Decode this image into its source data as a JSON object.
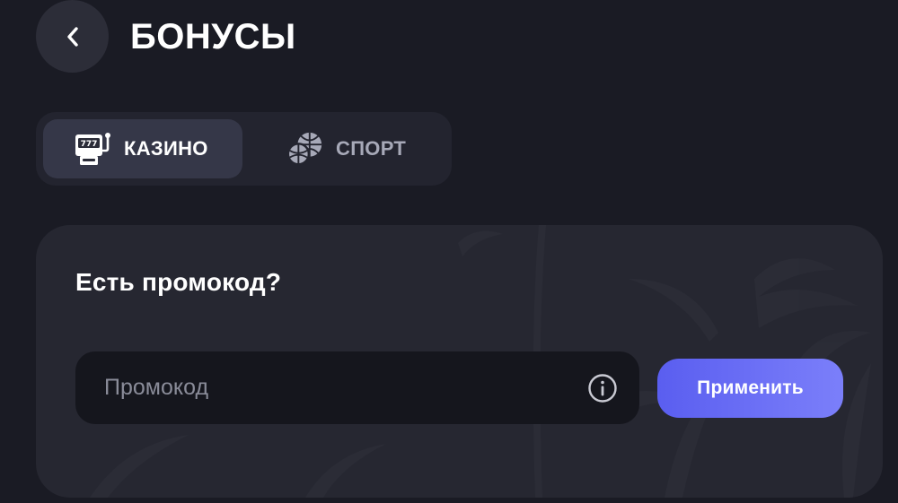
{
  "header": {
    "back_icon": "chevron-left-icon",
    "title": "БОНУСЫ"
  },
  "tabs": [
    {
      "label": "КАЗИНО",
      "icon": "slot-machine-icon",
      "active": true
    },
    {
      "label": "СПОРТ",
      "icon": "sports-balls-icon",
      "active": false
    }
  ],
  "promo": {
    "title": "Есть промокод?",
    "input_value": "",
    "input_placeholder": "Промокод",
    "info_icon": "info-icon",
    "apply_label": "Применить"
  },
  "colors": {
    "background": "#1a1b24",
    "card": "#262731",
    "active_tab": "#353748",
    "accent_start": "#5a5ef0",
    "accent_end": "#7b7ffa"
  }
}
